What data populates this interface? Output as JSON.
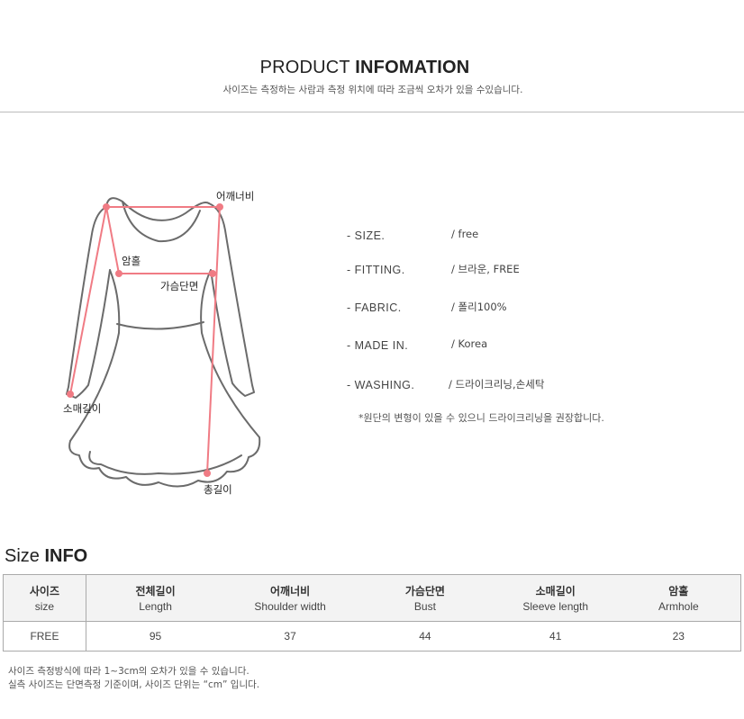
{
  "header": {
    "title_light": "PRODUCT ",
    "title_bold": "INFOMATION",
    "subtitle": "사이즈는 측정하는 사람과 측정 위치에 따라 조금씩 오차가 있을 수있습니다."
  },
  "diagram": {
    "labels": {
      "shoulder": "어깨너비",
      "armhole": "암홀",
      "bust": "가슴단면",
      "sleeve": "소매길이",
      "length": "총길이"
    },
    "colors": {
      "outline": "#6b6b6b",
      "measure": "#f07b84"
    }
  },
  "specs": {
    "rows": [
      {
        "key": "- SIZE.",
        "value": "/ free"
      },
      {
        "key": "- FITTING.",
        "value": "/ 브라운, FREE"
      },
      {
        "key": "- FABRIC.",
        "value": "/ 폴리100%"
      },
      {
        "key": "- MADE IN.",
        "value": "/ Korea"
      },
      {
        "key": "- WASHING.",
        "value": "/ 드라이크리닝,손세탁"
      }
    ],
    "note": "*원단의 변형이 있을 수 있으니 드라이크리닝을 권장합니다."
  },
  "size_info": {
    "title_light": "Size ",
    "title_bold": "INFO",
    "columns": [
      {
        "ko": "사이즈",
        "en": "size"
      },
      {
        "ko": "전체길이",
        "en": "Length"
      },
      {
        "ko": "어깨너비",
        "en": "Shoulder  width"
      },
      {
        "ko": "가슴단면",
        "en": "Bust"
      },
      {
        "ko": "소매길이",
        "en": "Sleeve length"
      },
      {
        "ko": "암홀",
        "en": "Armhole"
      }
    ],
    "row": [
      "FREE",
      "95",
      "37",
      "44",
      "41",
      "23"
    ]
  },
  "footnotes": {
    "line1": "사이즈 측정방식에 따라 1~3cm의 오차가 있을 수 있습니다.",
    "line2": "실측 사이즈는 단면측정 기준이며, 사이즈 단위는 “cm” 입니다."
  }
}
